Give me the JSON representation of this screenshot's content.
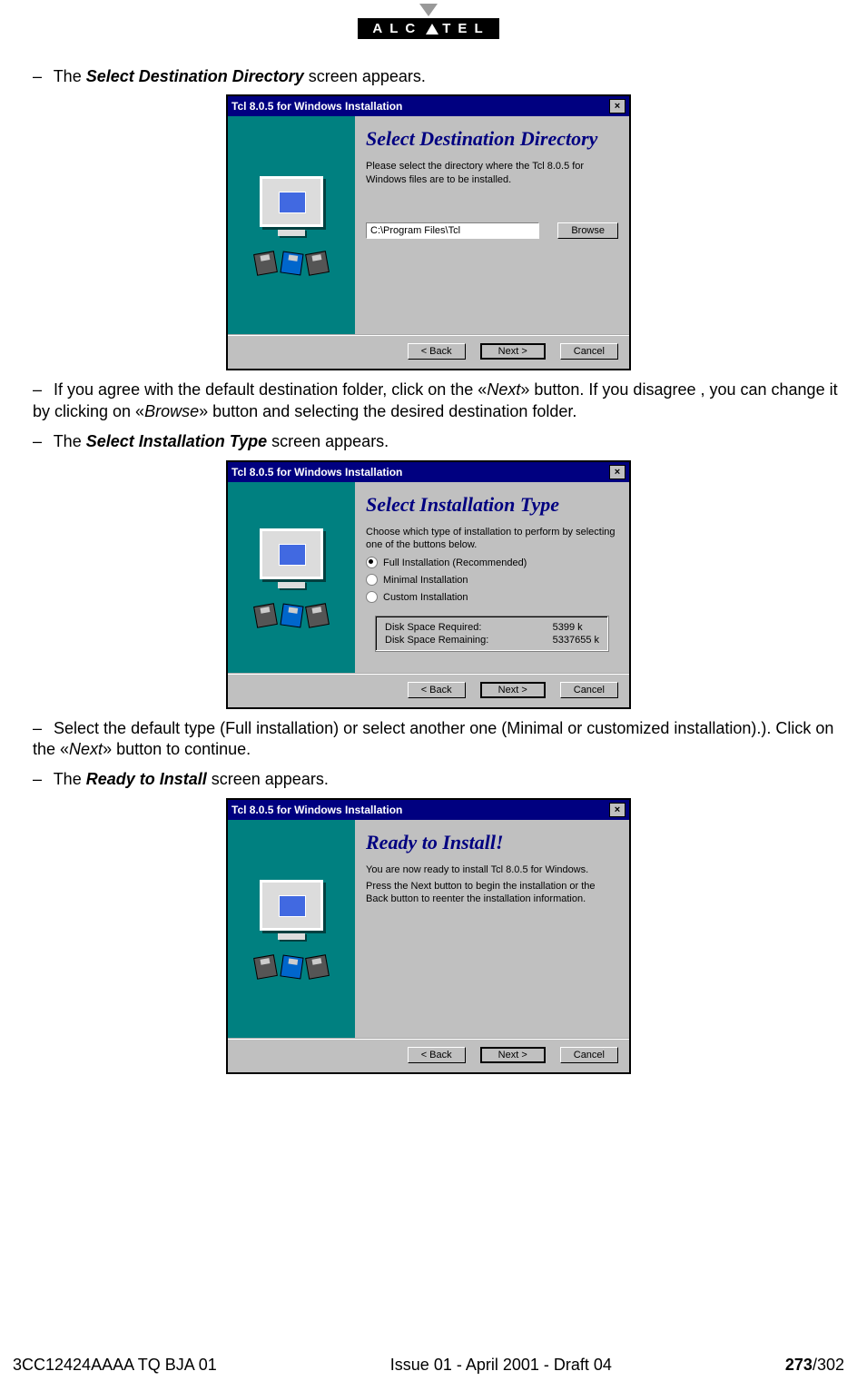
{
  "brand": "ALCATEL",
  "step1": {
    "intro_pre": "The ",
    "intro_strong": "Select Destination Directory",
    "intro_post": " screen appears.",
    "title": "Tcl 8.0.5 for Windows Installation",
    "heading": "Select Destination Directory",
    "para1": "Please select the directory where the Tcl 8.0.5 for Windows files are to be installed.",
    "path": "C:\\Program Files\\Tcl",
    "browse": "Browse",
    "back": "< Back",
    "next": "Next >",
    "cancel": "Cancel",
    "after": "If you agree with the default destination folder, click on the «Next» button. If you disagree , you can change it by clicking on «Browse» button and selecting the desired destination folder."
  },
  "step2": {
    "intro_pre": "The ",
    "intro_strong": "Select Installation Type",
    "intro_post": " screen appears.",
    "title": "Tcl 8.0.5 for Windows Installation",
    "heading": "Select Installation Type",
    "para1": "Choose which type of installation to perform by selecting one of the buttons below.",
    "opt1": "Full Installation (Recommended)",
    "opt2": "Minimal Installation",
    "opt3": "Custom Installation",
    "disk_req_label": "Disk Space Required:",
    "disk_req_val": "5399 k",
    "disk_rem_label": "Disk Space Remaining:",
    "disk_rem_val": "5337655 k",
    "back": "< Back",
    "next": "Next >",
    "cancel": "Cancel",
    "after": "Select the default type (Full installation) or select another one (Minimal or customized installation).). Click on the «Next» button to continue."
  },
  "step3": {
    "intro_pre": "The ",
    "intro_strong": "Ready to Install",
    "intro_post": " screen appears.",
    "title": "Tcl 8.0.5 for Windows Installation",
    "heading": "Ready to Install!",
    "para1": "You are now ready to install Tcl 8.0.5 for Windows.",
    "para2": "Press the Next button to begin the installation or the Back button to reenter the installation information.",
    "back": "< Back",
    "next": "Next >",
    "cancel": "Cancel"
  },
  "footer": {
    "doc_id": "3CC12424AAAA TQ BJA 01",
    "issue": "Issue 01 - April 2001 - Draft 04",
    "page_bold": "273",
    "page_total": "/302"
  }
}
